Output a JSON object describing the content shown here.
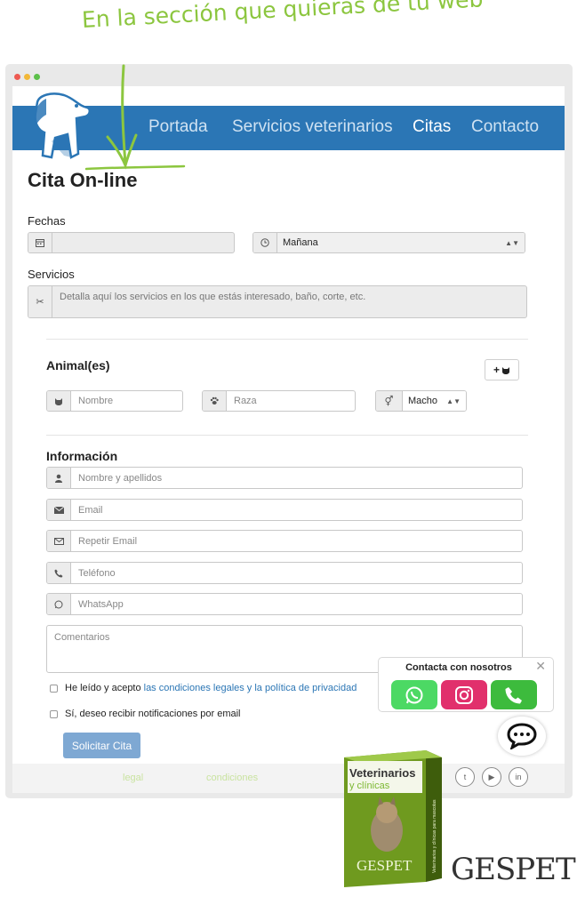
{
  "tagline": "En la sección que quieras de tu web",
  "nav": {
    "items": [
      "Portada",
      "Servicios veterinarios",
      "Citas",
      "Contacto"
    ],
    "active": "Citas"
  },
  "page_title": "Cita On-line",
  "fechas": {
    "label": "Fechas",
    "date_placeholder": "",
    "turno_value": "Mañana"
  },
  "servicios": {
    "label": "Servicios",
    "placeholder": "Detalla aquí los servicios en los que estás interesado, baño, corte, etc."
  },
  "animales": {
    "label": "Animal(es)",
    "add_button": "+",
    "nombre_placeholder": "Nombre",
    "raza_placeholder": "Raza",
    "sexo_value": "Macho"
  },
  "informacion": {
    "label": "Información",
    "nombre_placeholder": "Nombre y apellidos",
    "email_placeholder": "Email",
    "repetir_email_placeholder": "Repetir Email",
    "telefono_placeholder": "Teléfono",
    "whatsapp_placeholder": "WhatsApp",
    "comentarios_placeholder": "Comentarios"
  },
  "checks": {
    "terms_prefix": "He leído y acepto",
    "terms_link": "las condiciones legales y la política de privacidad",
    "notifications": "Sí, deseo recibir notificaciones por email"
  },
  "submit_label": "Solicitar Cita",
  "footer": {
    "link1": "legal",
    "link2": "condiciones"
  },
  "contact": {
    "title": "Contacta con nosotros",
    "close": "✕"
  },
  "product": {
    "line1": "Veterinarios",
    "line2": "y clínicas",
    "box_brand": "GESPET",
    "side_text": "Veterinarios y clínicas para mascotas"
  },
  "brand": "GESPET",
  "colors": {
    "nav_bg": "#2b76b5",
    "accent_green": "#8cc63f",
    "whatsapp": "#4cd964",
    "instagram": "#e1306c",
    "phone": "#3dbb3d",
    "submit": "#7ea8d3"
  }
}
